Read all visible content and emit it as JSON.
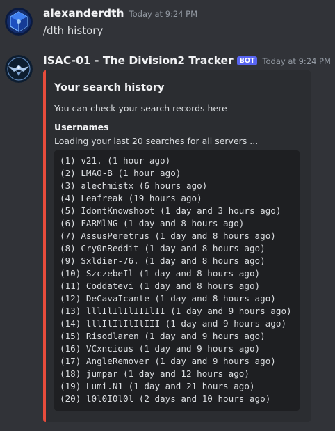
{
  "messages": [
    {
      "username": "alexanderdth",
      "timestamp": "Today at 9:24 PM",
      "content": "/dth history"
    },
    {
      "username": "ISAC-01 - The Division2 Tracker",
      "badge": "BOT",
      "timestamp": "Today at 9:24 PM"
    }
  ],
  "embed": {
    "accent_color": "#e74c3c",
    "title": "Your search history",
    "description": "You can check your search records here",
    "field_name": "Usernames",
    "field_value": "Loading your last 20 searches for all servers ...",
    "history": [
      "(1) v21. (1 hour ago)",
      "(2) LMAO-B (1 hour ago)",
      "(3) alechmistx (6 hours ago)",
      "(4) Leafreak (19 hours ago)",
      "(5) IdontKnowshoot (1 day and 3 hours ago)",
      "(6) FARMlNG (1 day and 8 hours ago)",
      "(7) AssusPeretrus (1 day and 8 hours ago)",
      "(8) Cry0nReddit (1 day and 8 hours ago)",
      "(9) Sxldier-76. (1 day and 8 hours ago)",
      "(10) SzczebeIl (1 day and 8 hours ago)",
      "(11) Coddatevi (1 day and 8 hours ago)",
      "(12) DeCavaIcante (1 day and 8 hours ago)",
      "(13) lllIlIlIlIIIlII (1 day and 9 hours ago)",
      "(14) lllIlIlIlIlIII (1 day and 9 hours ago)",
      "(15) Risodlaren (1 day and 9 hours ago)",
      "(16) VCxncious (1 day and 9 hours ago)",
      "(17) AngleRemover (1 day and 9 hours ago)",
      "(18) jumpar (1 day and 12 hours ago)",
      "(19) Lumi.N1 (1 day and 21 hours ago)",
      "(20) l0l0I0l0l (2 days and 10 hours ago)"
    ]
  },
  "icons": {
    "user_avatar": "cube-logo-avatar-icon",
    "bot_avatar": "shdc-eagle-avatar-icon"
  },
  "colors": {
    "background": "#313338",
    "embed_background": "#2b2d31",
    "code_background": "#1e1f22",
    "bot_badge": "#5865f2"
  }
}
